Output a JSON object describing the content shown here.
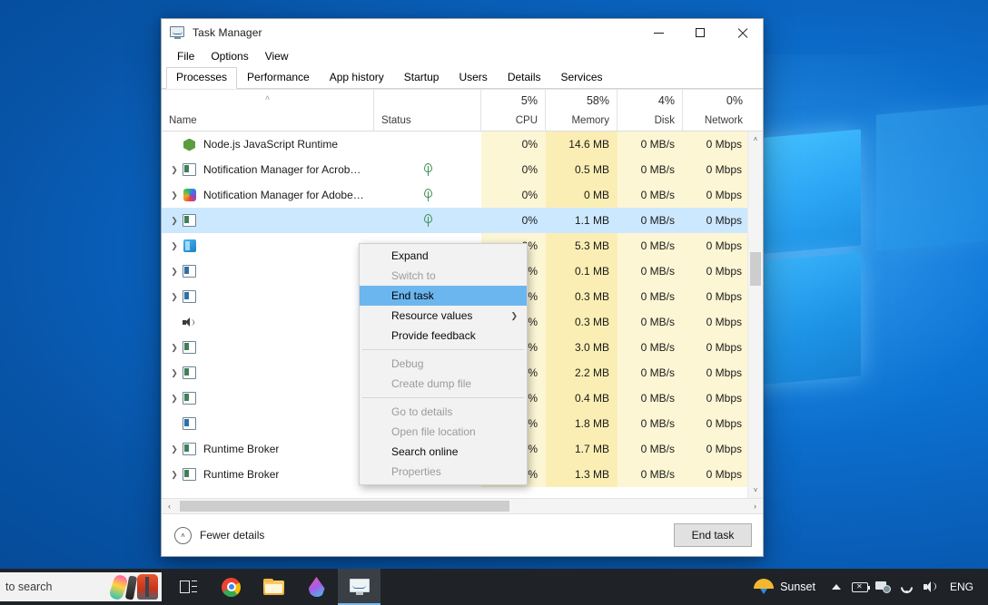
{
  "window": {
    "title": "Task Manager",
    "icon": "taskmanager-icon",
    "minimize": "–",
    "maximize": "□",
    "close": "×"
  },
  "menubar": [
    "File",
    "Options",
    "View"
  ],
  "tabs": [
    {
      "label": "Processes",
      "active": true
    },
    {
      "label": "Performance",
      "active": false
    },
    {
      "label": "App history",
      "active": false
    },
    {
      "label": "Startup",
      "active": false
    },
    {
      "label": "Users",
      "active": false
    },
    {
      "label": "Details",
      "active": false
    },
    {
      "label": "Services",
      "active": false
    }
  ],
  "columns": [
    {
      "key": "name",
      "label": "Name",
      "pct": "",
      "sort": "˄"
    },
    {
      "key": "status",
      "label": "Status",
      "pct": ""
    },
    {
      "key": "cpu",
      "label": "CPU",
      "pct": "5%"
    },
    {
      "key": "memory",
      "label": "Memory",
      "pct": "58%"
    },
    {
      "key": "disk",
      "label": "Disk",
      "pct": "4%"
    },
    {
      "key": "network",
      "label": "Network",
      "pct": "0%"
    }
  ],
  "rows": [
    {
      "name": "Node.js JavaScript Runtime",
      "icon": "nodejs-icon",
      "expandable": false,
      "leaf": false,
      "cpu": "0%",
      "memory": "14.6 MB",
      "disk": "0 MB/s",
      "network": "0 Mbps",
      "selected": false
    },
    {
      "name": "Notification Manager for Acrob…",
      "icon": "window-icon",
      "expandable": true,
      "leaf": true,
      "cpu": "0%",
      "memory": "0.5 MB",
      "disk": "0 MB/s",
      "network": "0 Mbps",
      "selected": false
    },
    {
      "name": "Notification Manager for Adobe…",
      "icon": "adobe-icon",
      "expandable": true,
      "leaf": true,
      "cpu": "0%",
      "memory": "0 MB",
      "disk": "0 MB/s",
      "network": "0 Mbps",
      "selected": false
    },
    {
      "name": "",
      "icon": "window-icon",
      "expandable": true,
      "leaf": true,
      "cpu": "0%",
      "memory": "1.1 MB",
      "disk": "0 MB/s",
      "network": "0 Mbps",
      "selected": true
    },
    {
      "name": "",
      "icon": "blue-app-icon",
      "expandable": true,
      "leaf": false,
      "cpu": "0%",
      "memory": "5.3 MB",
      "disk": "0 MB/s",
      "network": "0 Mbps",
      "selected": false
    },
    {
      "name": "",
      "icon": "window-blue-icon",
      "expandable": true,
      "leaf": false,
      "cpu": "0%",
      "memory": "0.1 MB",
      "disk": "0 MB/s",
      "network": "0 Mbps",
      "selected": false
    },
    {
      "name": "",
      "icon": "window-blue-icon",
      "expandable": true,
      "leaf": false,
      "cpu": "0%",
      "memory": "0.3 MB",
      "disk": "0 MB/s",
      "network": "0 Mbps",
      "selected": false
    },
    {
      "name": "",
      "icon": "speaker-icon",
      "expandable": false,
      "leaf": false,
      "cpu": "0%",
      "memory": "0.3 MB",
      "disk": "0 MB/s",
      "network": "0 Mbps",
      "selected": false
    },
    {
      "name": "",
      "icon": "window-icon",
      "expandable": true,
      "leaf": false,
      "cpu": "0%",
      "memory": "3.0 MB",
      "disk": "0 MB/s",
      "network": "0 Mbps",
      "selected": false
    },
    {
      "name": "",
      "icon": "window-icon",
      "expandable": true,
      "leaf": false,
      "cpu": "0%",
      "memory": "2.2 MB",
      "disk": "0 MB/s",
      "network": "0 Mbps",
      "selected": false
    },
    {
      "name": "",
      "icon": "window-icon",
      "expandable": true,
      "leaf": false,
      "cpu": "0%",
      "memory": "0.4 MB",
      "disk": "0 MB/s",
      "network": "0 Mbps",
      "selected": false
    },
    {
      "name": "",
      "icon": "window-blue-icon",
      "expandable": false,
      "leaf": false,
      "cpu": "0%",
      "memory": "1.8 MB",
      "disk": "0 MB/s",
      "network": "0 Mbps",
      "selected": false
    },
    {
      "name": "Runtime Broker",
      "icon": "window-icon",
      "expandable": true,
      "leaf": false,
      "cpu": "0%",
      "memory": "1.7 MB",
      "disk": "0 MB/s",
      "network": "0 Mbps",
      "selected": false
    },
    {
      "name": "Runtime Broker",
      "icon": "window-icon",
      "expandable": true,
      "leaf": false,
      "cpu": "0%",
      "memory": "1.3 MB",
      "disk": "0 MB/s",
      "network": "0 Mbps",
      "selected": false
    }
  ],
  "context_menu": [
    {
      "label": "Expand",
      "disabled": false,
      "highlighted": false,
      "submenu": false
    },
    {
      "label": "Switch to",
      "disabled": true,
      "highlighted": false,
      "submenu": false
    },
    {
      "label": "End task",
      "disabled": false,
      "highlighted": true,
      "submenu": false
    },
    {
      "label": "Resource values",
      "disabled": false,
      "highlighted": false,
      "submenu": true
    },
    {
      "label": "Provide feedback",
      "disabled": false,
      "highlighted": false,
      "submenu": false
    },
    {
      "separator": true
    },
    {
      "label": "Debug",
      "disabled": true,
      "highlighted": false,
      "submenu": false
    },
    {
      "label": "Create dump file",
      "disabled": true,
      "highlighted": false,
      "submenu": false
    },
    {
      "separator": true
    },
    {
      "label": "Go to details",
      "disabled": true,
      "highlighted": false,
      "submenu": false
    },
    {
      "label": "Open file location",
      "disabled": true,
      "highlighted": false,
      "submenu": false
    },
    {
      "label": "Search online",
      "disabled": false,
      "highlighted": false,
      "submenu": false
    },
    {
      "label": "Properties",
      "disabled": true,
      "highlighted": false,
      "submenu": false
    }
  ],
  "statusbar": {
    "fewer_details": "Fewer details",
    "fewer_icon": "˄",
    "end_task": "End task"
  },
  "scrollbars": {
    "up_arrow": "˄",
    "down_arrow": "˅",
    "left_arrow": "‹",
    "right_arrow": "›"
  },
  "taskbar": {
    "search_text": "to search",
    "buttons": [
      {
        "name": "task-view",
        "icon": "task-view-icon",
        "active": false
      },
      {
        "name": "chrome",
        "icon": "chrome-icon",
        "active": false
      },
      {
        "name": "file-explorer",
        "icon": "folder-icon",
        "active": false
      },
      {
        "name": "paint-3d",
        "icon": "paint3d-icon",
        "active": false
      },
      {
        "name": "task-manager",
        "icon": "taskmanager-icon",
        "active": true
      }
    ],
    "weather": "Sunset",
    "language": "ENG"
  },
  "colors": {
    "accent": "#0078d7",
    "selection": "#cce8ff",
    "menu_highlight": "#6cb6f0",
    "cpu_column": "#fdf6d5",
    "memory_column": "#fbeeb4",
    "taskbar": "#1f2327"
  }
}
